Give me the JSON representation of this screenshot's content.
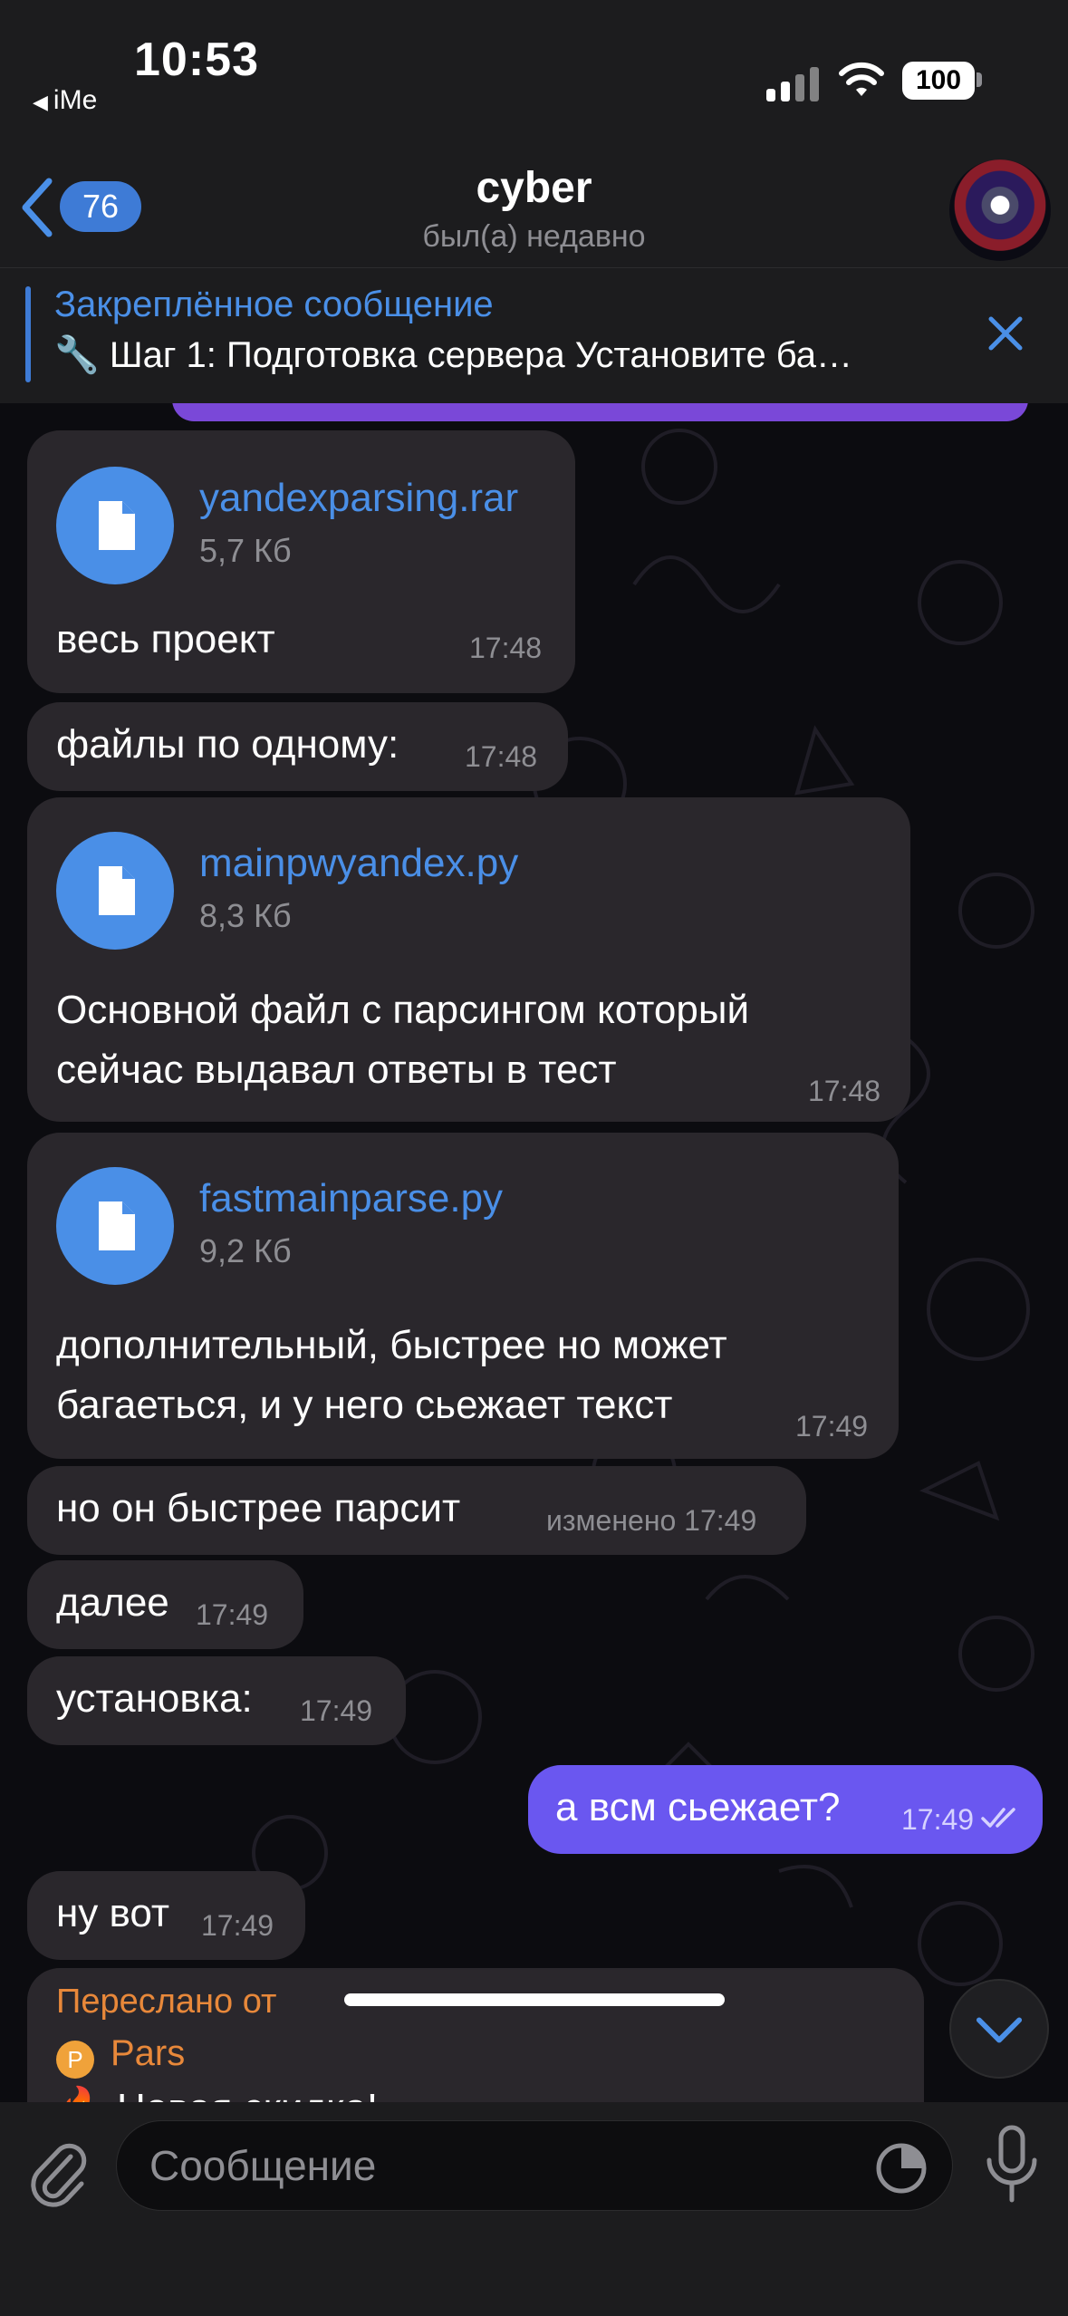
{
  "status_bar": {
    "time": "10:53",
    "back_app": "iMe",
    "battery": "100",
    "icons": [
      "signal-icon",
      "wifi-icon",
      "battery-icon"
    ]
  },
  "header": {
    "unread_count": "76",
    "title": "cyber",
    "subtitle": "был(а) недавно"
  },
  "pinned": {
    "title": "Закреплённое сообщение",
    "text": "🔧 Шаг 1: Подготовка сервера Установите ба…"
  },
  "messages": [
    {
      "type": "file",
      "file_name": "yandexparsing.rar",
      "file_size": "5,7 Кб",
      "text": "весь проект",
      "time": "17:48"
    },
    {
      "type": "text",
      "text": "файлы по одному:",
      "time": "17:48"
    },
    {
      "type": "file",
      "file_name": "mainpwyandex.py",
      "file_size": "8,3 Кб",
      "lines": [
        "Основной файл с парсингом который",
        "сейчас выдавал ответы в тест"
      ],
      "time": "17:48"
    },
    {
      "type": "file",
      "file_name": "fastmainparse.py",
      "file_size": "9,2 Кб",
      "lines": [
        "дополнительный, быстрее но может",
        "багаеться, и у него сьежает текст"
      ],
      "time": "17:49"
    },
    {
      "type": "text",
      "text": "но он быстрее парсит",
      "time": "изменено 17:49"
    },
    {
      "type": "text",
      "text": "далее",
      "time": "17:49"
    },
    {
      "type": "text",
      "text": "установка:",
      "time": "17:49"
    },
    {
      "type": "outgoing",
      "text": "а всм сьежает?",
      "time": "17:49"
    },
    {
      "type": "text",
      "text": "ну вот",
      "time": "17:49"
    },
    {
      "type": "forward",
      "label": "Переслано от",
      "from": "Pars",
      "from_initial": "P",
      "text": "🔥 Новая скидка!"
    }
  ],
  "input": {
    "placeholder": "Сообщение"
  },
  "colors": {
    "accent": "#4a8fe7",
    "outgoing_bubble": "#6a57f0",
    "incoming_bubble": "#2a272c",
    "forward": "#e8883a"
  }
}
